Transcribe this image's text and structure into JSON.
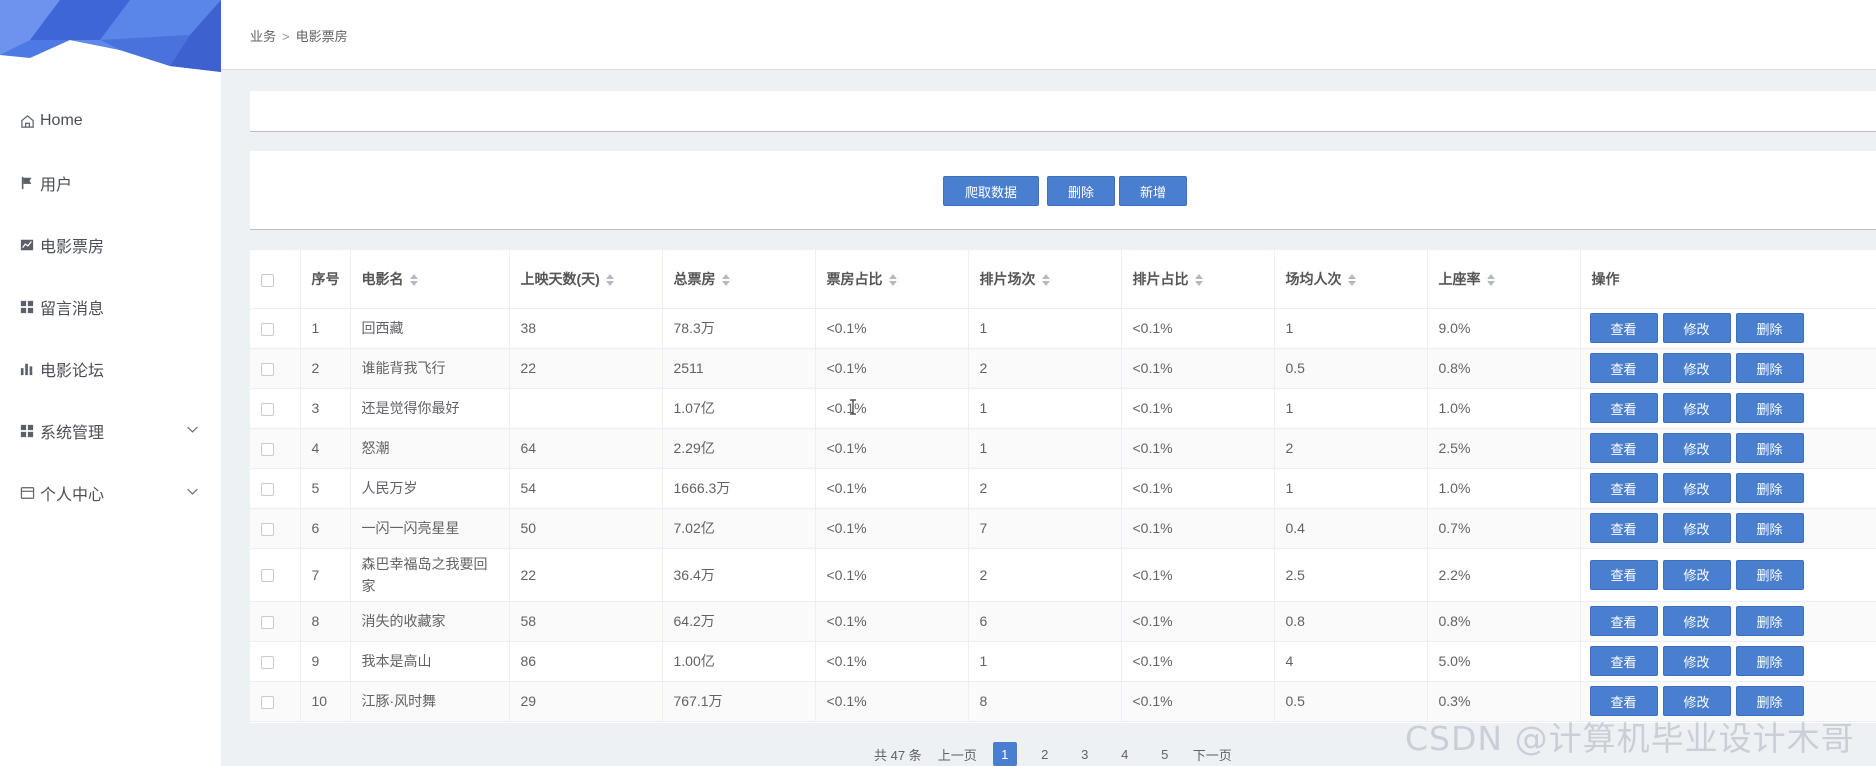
{
  "sidebar": {
    "items": [
      {
        "label": "Home",
        "icon": "home-icon"
      },
      {
        "label": "用户",
        "icon": "flag-icon"
      },
      {
        "label": "电影票房",
        "icon": "chart-icon"
      },
      {
        "label": "留言消息",
        "icon": "grid-icon"
      },
      {
        "label": "电影论坛",
        "icon": "bar-chart-icon"
      },
      {
        "label": "系统管理",
        "icon": "grid-icon",
        "expandable": true
      },
      {
        "label": "个人中心",
        "icon": "card-icon",
        "expandable": true
      }
    ]
  },
  "breadcrumb": {
    "parent": "业务",
    "separator": ">",
    "current": "电影票房"
  },
  "actions": {
    "crawl": "爬取数据",
    "delete": "删除",
    "add": "新增"
  },
  "table": {
    "headers": [
      "序号",
      "电影名",
      "上映天数(天)",
      "总票房",
      "票房占比",
      "排片场次",
      "排片占比",
      "场均人次",
      "上座率",
      "操作"
    ],
    "row_actions": {
      "view": "查看",
      "edit": "修改",
      "delete": "删除"
    },
    "rows": [
      {
        "no": "1",
        "name": "回西藏",
        "days": "38",
        "gross": "78.3万",
        "gross_share": "<0.1%",
        "screenings": "1",
        "screen_share": "<0.1%",
        "avg_viewers": "1",
        "occupancy": "9.0%"
      },
      {
        "no": "2",
        "name": "谁能背我飞行",
        "days": "22",
        "gross": "2511",
        "gross_share": "<0.1%",
        "screenings": "2",
        "screen_share": "<0.1%",
        "avg_viewers": "0.5",
        "occupancy": "0.8%"
      },
      {
        "no": "3",
        "name": "还是觉得你最好",
        "days": "",
        "gross": "1.07亿",
        "gross_share": "<0.1%",
        "screenings": "1",
        "screen_share": "<0.1%",
        "avg_viewers": "1",
        "occupancy": "1.0%"
      },
      {
        "no": "4",
        "name": "怒潮",
        "days": "64",
        "gross": "2.29亿",
        "gross_share": "<0.1%",
        "screenings": "1",
        "screen_share": "<0.1%",
        "avg_viewers": "2",
        "occupancy": "2.5%"
      },
      {
        "no": "5",
        "name": "人民万岁",
        "days": "54",
        "gross": "1666.3万",
        "gross_share": "<0.1%",
        "screenings": "2",
        "screen_share": "<0.1%",
        "avg_viewers": "1",
        "occupancy": "1.0%"
      },
      {
        "no": "6",
        "name": "一闪一闪亮星星",
        "days": "50",
        "gross": "7.02亿",
        "gross_share": "<0.1%",
        "screenings": "7",
        "screen_share": "<0.1%",
        "avg_viewers": "0.4",
        "occupancy": "0.7%"
      },
      {
        "no": "7",
        "name": "森巴幸福岛之我要回家",
        "days": "22",
        "gross": "36.4万",
        "gross_share": "<0.1%",
        "screenings": "2",
        "screen_share": "<0.1%",
        "avg_viewers": "2.5",
        "occupancy": "2.2%"
      },
      {
        "no": "8",
        "name": "消失的收藏家",
        "days": "58",
        "gross": "64.2万",
        "gross_share": "<0.1%",
        "screenings": "6",
        "screen_share": "<0.1%",
        "avg_viewers": "0.8",
        "occupancy": "0.8%"
      },
      {
        "no": "9",
        "name": "我本是高山",
        "days": "86",
        "gross": "1.00亿",
        "gross_share": "<0.1%",
        "screenings": "1",
        "screen_share": "<0.1%",
        "avg_viewers": "4",
        "occupancy": "5.0%"
      },
      {
        "no": "10",
        "name": "江豚·风时舞",
        "days": "29",
        "gross": "767.1万",
        "gross_share": "<0.1%",
        "screenings": "8",
        "screen_share": "<0.1%",
        "avg_viewers": "0.5",
        "occupancy": "0.3%"
      }
    ]
  },
  "pagination": {
    "total": "共 47 条",
    "prev": "上一页",
    "pages": [
      "1",
      "2",
      "3",
      "4",
      "5"
    ],
    "current": "1",
    "next": "下一页"
  },
  "watermark": "CSDN @计算机毕业设计木哥",
  "colors": {
    "primary": "#4a7fd0",
    "banner": "#4a76e0"
  }
}
